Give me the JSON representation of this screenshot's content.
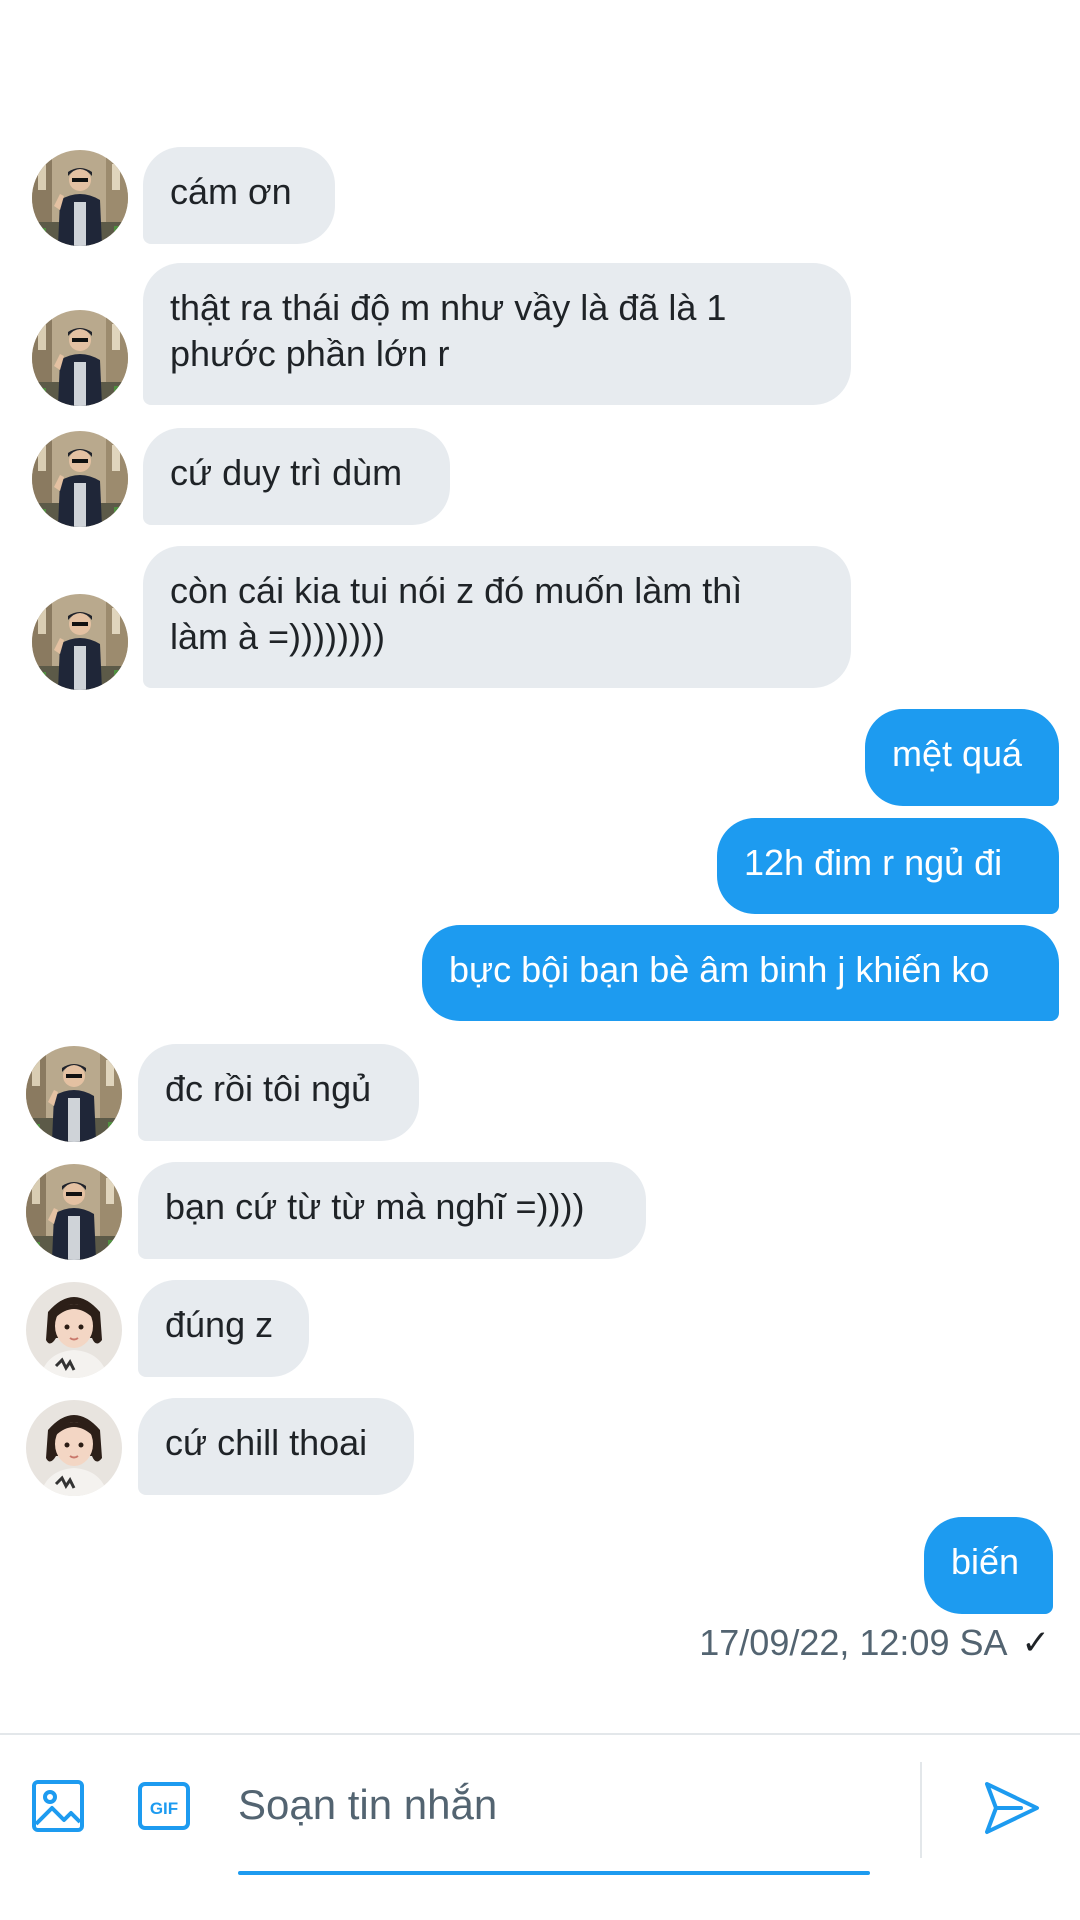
{
  "messages": [
    {
      "side": "in",
      "avatar": "man",
      "text": "cám ơn"
    },
    {
      "side": "in",
      "avatar": "man",
      "text": "thật ra thái độ m như vầy là đã là 1\nphước phần lớn r"
    },
    {
      "side": "in",
      "avatar": "man",
      "text": "cứ duy trì dùm"
    },
    {
      "side": "in",
      "avatar": "man",
      "text": "còn cái kia tui nói z đó muốn làm thì\nlàm à =))))))))"
    },
    {
      "side": "out",
      "text": "mệt quá"
    },
    {
      "side": "out",
      "text": "12h đim r ngủ đi"
    },
    {
      "side": "out",
      "text": "bực bội bạn bè âm binh j khiến ko"
    },
    {
      "side": "in",
      "avatar": "man",
      "text": "đc rồi tôi ngủ"
    },
    {
      "side": "in",
      "avatar": "man",
      "text": "bạn cứ từ từ mà nghĩ =))))"
    },
    {
      "side": "in",
      "avatar": "girl",
      "text": "đúng z"
    },
    {
      "side": "in",
      "avatar": "girl",
      "text": "cứ chill thoai"
    },
    {
      "side": "out",
      "text": "biến"
    }
  ],
  "status": {
    "timestamp": "17/09/22, 12:09 SA",
    "check": "✓"
  },
  "composer": {
    "placeholder": "Soạn tin nhắn",
    "icons": [
      "image-icon",
      "gif-icon",
      "send-icon"
    ],
    "gif_label": "GIF"
  },
  "colors": {
    "accent": "#1d9bf0",
    "incoming_bubble": "#e7ebef",
    "secondary_text": "#536471"
  }
}
